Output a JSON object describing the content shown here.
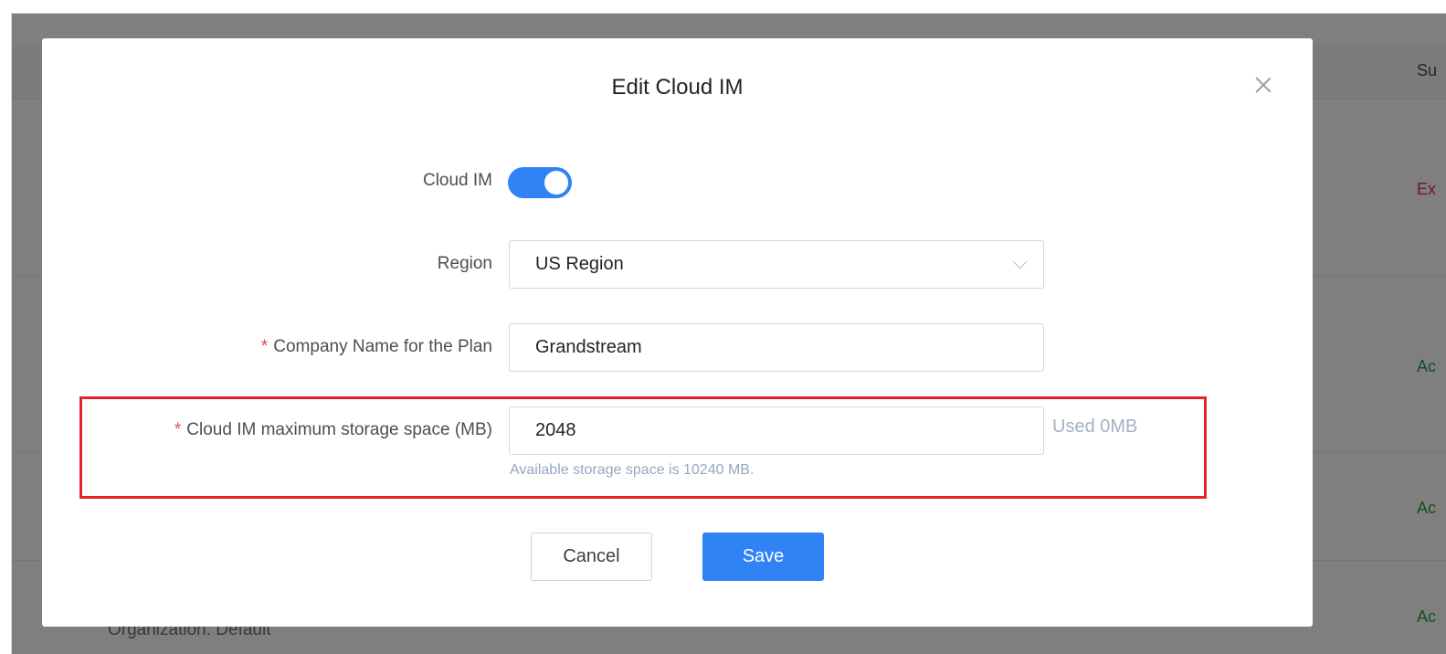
{
  "background": {
    "header_col": "Su",
    "row_statuses": [
      {
        "text": "Ex",
        "color": "#d9363e"
      },
      {
        "text": "Ac",
        "color": "#27a043"
      },
      {
        "text": "Ac",
        "color": "#27a043"
      },
      {
        "text": "Ac",
        "color": "#27a043"
      }
    ],
    "organization_text": "Organization: Default"
  },
  "modal": {
    "title": "Edit Cloud IM",
    "close_icon": "close-icon",
    "fields": {
      "cloud_im": {
        "label": "Cloud IM",
        "enabled": true
      },
      "region": {
        "label": "Region",
        "value": "US Region",
        "icon": "chevron-down-icon"
      },
      "company_name": {
        "required_mark": "*",
        "label": "Company Name for the Plan",
        "value": "Grandstream"
      },
      "storage": {
        "required_mark": "*",
        "label": "Cloud IM maximum storage space (MB)",
        "value": "2048",
        "used": "Used 0MB",
        "hint": "Available storage space is 10240 MB."
      }
    },
    "buttons": {
      "cancel": "Cancel",
      "save": "Save"
    }
  },
  "colors": {
    "accent": "#2f83f5",
    "required": "#e5484d",
    "highlight": "#e3242b"
  }
}
